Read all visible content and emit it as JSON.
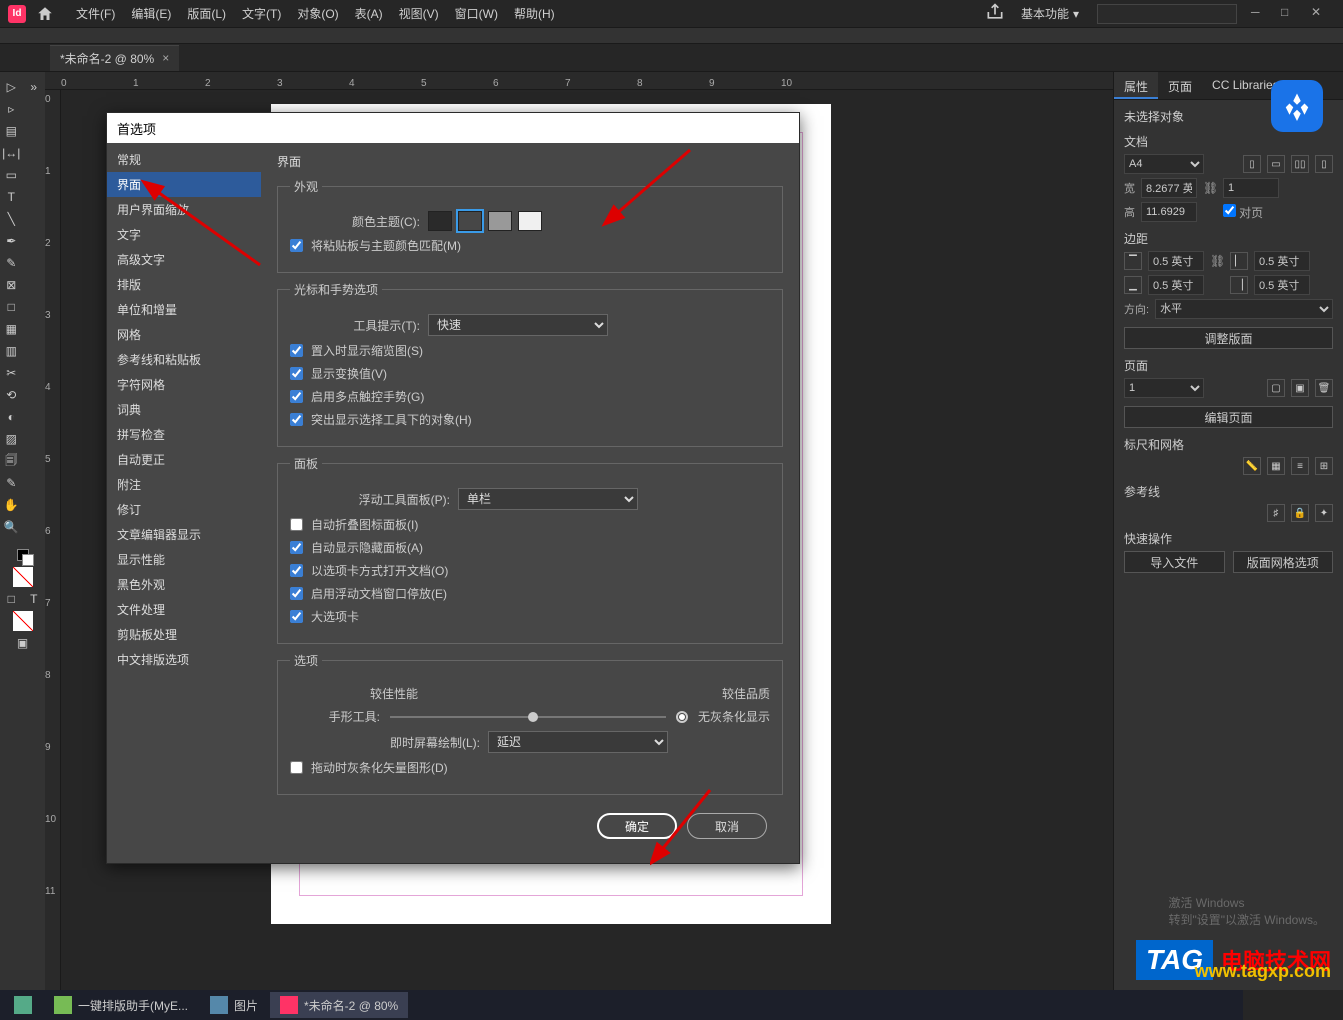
{
  "menubar": {
    "items": [
      "文件(F)",
      "编辑(E)",
      "版面(L)",
      "文字(T)",
      "对象(O)",
      "表(A)",
      "视图(V)",
      "窗口(W)",
      "帮助(H)"
    ],
    "workspace": "基本功能"
  },
  "tab": {
    "label": "*未命名-2 @ 80%"
  },
  "ruler_top": [
    "0",
    "1",
    "2",
    "3",
    "4",
    "5",
    "6",
    "7",
    "8",
    "9",
    "10"
  ],
  "ruler_left": [
    "0",
    "1",
    "2",
    "3",
    "4",
    "5",
    "6",
    "7",
    "8",
    "9",
    "10",
    "11"
  ],
  "panel": {
    "tabs": [
      "属性",
      "页面",
      "CC Libraries"
    ],
    "no_sel": "未选择对象",
    "doc": "文档",
    "preset": "A4",
    "w_label": "宽",
    "w": "8.2677 英",
    "h_label": "高",
    "h": "11.6929",
    "facing": "对页",
    "margin": "边距",
    "m_top": "0.5 英寸",
    "m_bottom": "0.5 英寸",
    "m_left": "0.5 英寸",
    "m_right": "0.5 英寸",
    "orient": "方向:",
    "orient_val": "水平",
    "adjust": "调整版面",
    "page": "页面",
    "page_val": "1",
    "edit_page": "编辑页面",
    "ruler_grid": "标尺和网格",
    "guides": "参考线",
    "quick": "快速操作",
    "import": "导入文件",
    "layout_opts": "版面网格选项"
  },
  "dialog": {
    "title": "首选项",
    "sidebar": [
      "常规",
      "界面",
      "用户界面缩放",
      "文字",
      "高级文字",
      "排版",
      "单位和增量",
      "网格",
      "参考线和粘贴板",
      "字符网格",
      "词典",
      "拼写检查",
      "自动更正",
      "附注",
      "修订",
      "文章编辑器显示",
      "显示性能",
      "黑色外观",
      "文件处理",
      "剪贴板处理",
      "中文排版选项"
    ],
    "active_sidebar": 1,
    "heading": "界面",
    "appearance": {
      "legend": "外观",
      "theme_label": "颜色主题(C):",
      "match": "将粘贴板与主题颜色匹配(M)"
    },
    "cursor": {
      "legend": "光标和手势选项",
      "hint_label": "工具提示(T):",
      "hint_val": "快速",
      "thumb": "置入时显示缩览图(S)",
      "transform": "显示变换值(V)",
      "touch": "启用多点触控手势(G)",
      "highlight": "突出显示选择工具下的对象(H)"
    },
    "panels_sect": {
      "legend": "面板",
      "float_label": "浮动工具面板(P):",
      "float_val": "单栏",
      "collapse": "自动折叠图标面板(I)",
      "autoshow": "自动显示隐藏面板(A)",
      "tabs": "以选项卡方式打开文档(O)",
      "dock": "启用浮动文档窗口停放(E)",
      "big": "大选项卡"
    },
    "options_sect": {
      "legend": "选项",
      "hand_label": "手形工具:",
      "perf": "较佳性能",
      "qual": "较佳品质",
      "nogray": "无灰条化显示",
      "draw_label": "即时屏幕绘制(L):",
      "draw_val": "延迟",
      "vector": "拖动时灰条化矢量图形(D)"
    },
    "ok": "确定",
    "cancel": "取消"
  },
  "taskbar": {
    "items": [
      {
        "label": "一键排版助手(MyE..."
      },
      {
        "label": "图片"
      },
      {
        "label": "*未命名-2 @ 80%"
      }
    ]
  },
  "activate": {
    "title": "激活 Windows",
    "sub": "转到\"设置\"以激活 Windows。"
  },
  "watermark": {
    "tag": "TAG",
    "txt": "电脑技术网",
    "url": "www.tagxp.com"
  }
}
